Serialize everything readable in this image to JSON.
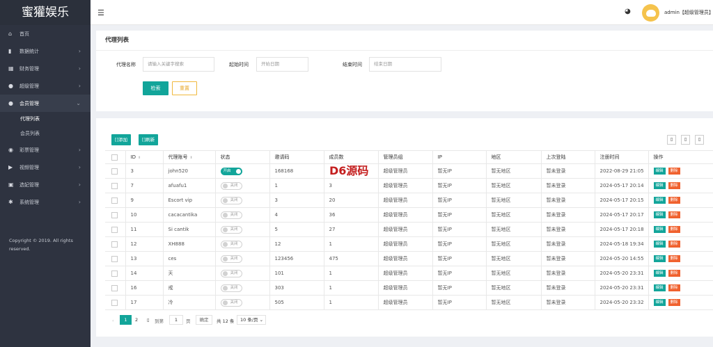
{
  "app": {
    "logo": "蜜獾娱乐",
    "copyright": "Copyright © 2019. All rights reserved."
  },
  "sidebar": {
    "items": [
      {
        "icon": "home-icon",
        "glyph": "⌂",
        "label": "首页",
        "arrow": ""
      },
      {
        "icon": "bar-chart-icon",
        "glyph": "▮",
        "label": "数据统计",
        "arrow": "›"
      },
      {
        "icon": "bank-icon",
        "glyph": "▦",
        "label": "财务管理",
        "arrow": "›"
      },
      {
        "icon": "user-icon",
        "glyph": "●",
        "label": "超级管理",
        "arrow": "›"
      },
      {
        "icon": "users-icon",
        "glyph": "●",
        "label": "会员管理",
        "arrow": "⌄"
      },
      {
        "icon": "gamepad-icon",
        "glyph": "◉",
        "label": "彩票管理",
        "arrow": "›"
      },
      {
        "icon": "video-icon",
        "glyph": "▶",
        "label": "视频管理",
        "arrow": "›"
      },
      {
        "icon": "ticket-icon",
        "glyph": "▣",
        "label": "选妃管理",
        "arrow": "›"
      },
      {
        "icon": "gear-icon",
        "glyph": "✱",
        "label": "系统管理",
        "arrow": "›"
      }
    ],
    "subitems": [
      "代理列表",
      "会员列表"
    ]
  },
  "header": {
    "menu_glyph": "☰",
    "palette_glyph": "◕",
    "user": "admin【超级管理员】"
  },
  "filter": {
    "title": "代理列表",
    "agent_label": "代理名称",
    "agent_placeholder": "请输入关键字搜索",
    "start_label": "起始时间",
    "start_placeholder": "开始日期",
    "end_label": "结束时间",
    "end_placeholder": "结束日期",
    "search_btn": "检索",
    "reset_btn": "重置"
  },
  "toolbar": {
    "add": "[]添加",
    "refresh": "[]刷新",
    "icons": [
      "▯",
      "▯",
      "▯"
    ]
  },
  "table": {
    "headers": [
      "ID",
      "代理账号",
      "状态",
      "邀请码",
      "成员数",
      "管理员组",
      "IP",
      "地区",
      "上次登陆",
      "注册时间",
      "操作"
    ],
    "sort_glyph": "⬍",
    "edit_label": "编辑",
    "delete_label": "删除",
    "rows": [
      {
        "id": "3",
        "account": "john520",
        "on": true,
        "status": "开启",
        "code": "168168",
        "members": "",
        "group": "超级管理员",
        "ip": "暂无IP",
        "region": "暂无地区",
        "last": "暂未登录",
        "reg": "2022-08-29 21:05"
      },
      {
        "id": "7",
        "account": "afuafu1",
        "on": false,
        "status": "关闭",
        "code": "1",
        "members": "3",
        "group": "超级管理员",
        "ip": "暂无IP",
        "region": "暂无地区",
        "last": "暂未登录",
        "reg": "2024-05-17 20:14"
      },
      {
        "id": "9",
        "account": "Escort vip",
        "on": false,
        "status": "关闭",
        "code": "3",
        "members": "20",
        "group": "超级管理员",
        "ip": "暂无IP",
        "region": "暂无地区",
        "last": "暂未登录",
        "reg": "2024-05-17 20:15"
      },
      {
        "id": "10",
        "account": "cacacantika",
        "on": false,
        "status": "关闭",
        "code": "4",
        "members": "36",
        "group": "超级管理员",
        "ip": "暂无IP",
        "region": "暂无地区",
        "last": "暂未登录",
        "reg": "2024-05-17 20:17"
      },
      {
        "id": "11",
        "account": "Si cantik",
        "on": false,
        "status": "关闭",
        "code": "5",
        "members": "27",
        "group": "超级管理员",
        "ip": "暂无IP",
        "region": "暂无地区",
        "last": "暂未登录",
        "reg": "2024-05-17 20:18"
      },
      {
        "id": "12",
        "account": "XH888",
        "on": false,
        "status": "关闭",
        "code": "12",
        "members": "1",
        "group": "超级管理员",
        "ip": "暂无IP",
        "region": "暂无地区",
        "last": "暂未登录",
        "reg": "2024-05-18 19:34"
      },
      {
        "id": "13",
        "account": "ces",
        "on": false,
        "status": "关闭",
        "code": "123456",
        "members": "475",
        "group": "超级管理员",
        "ip": "暂无IP",
        "region": "暂无地区",
        "last": "暂未登录",
        "reg": "2024-05-20 14:55"
      },
      {
        "id": "14",
        "account": "天",
        "on": false,
        "status": "关闭",
        "code": "101",
        "members": "1",
        "group": "超级管理员",
        "ip": "暂无IP",
        "region": "暂无地区",
        "last": "暂未登录",
        "reg": "2024-05-20 23:31"
      },
      {
        "id": "16",
        "account": "戒",
        "on": false,
        "status": "关闭",
        "code": "303",
        "members": "1",
        "group": "超级管理员",
        "ip": "暂无IP",
        "region": "暂无地区",
        "last": "暂未登录",
        "reg": "2024-05-20 23:31"
      },
      {
        "id": "17",
        "account": "冷",
        "on": false,
        "status": "关闭",
        "code": "505",
        "members": "1",
        "group": "超级管理员",
        "ip": "暂无IP",
        "region": "暂无地区",
        "last": "暂未登录",
        "reg": "2024-05-20 23:32"
      }
    ]
  },
  "pager": {
    "prev": "‹",
    "current": "1",
    "page2": "2",
    "next": "▯",
    "goto": "到第",
    "input": "1",
    "unit": "页",
    "ok": "确定",
    "total": "共 12 条",
    "size": "10 条/页 ⌄"
  },
  "watermark": "D6源码",
  "colors": {
    "accent": "#12a59a",
    "danger": "#f0612e",
    "warning": "#f0b83c",
    "sidebar": "#2e3340"
  }
}
